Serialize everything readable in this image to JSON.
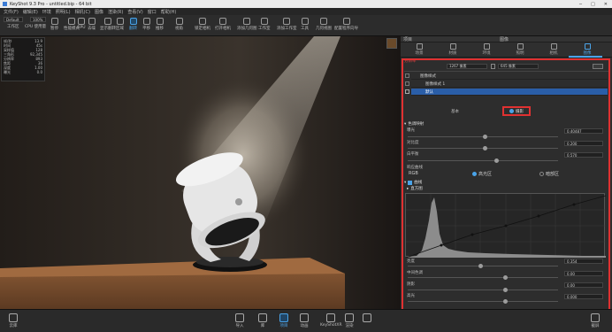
{
  "titlebar": {
    "title": "KeyShot 9.3 Pro - untitled.bip - 64 bit"
  },
  "menu": [
    "文件(F)",
    "编辑(E)",
    "环境",
    "照明(L)",
    "相机(C)",
    "图像",
    "渲染(R)",
    "查看(V)",
    "窗口",
    "帮助(H)"
  ],
  "toolbar": {
    "workspace": "Default",
    "cpu": "CPU 使用量",
    "pause": "暂停",
    "perf": "性能模式",
    "zoom": "100%",
    "items": [
      "工作区",
      "CPU 使用量",
      "暂停",
      "性能模式",
      "GPU",
      "去噪",
      "显示翻转",
      "区域",
      "翻转",
      "平移",
      "推移",
      "视角",
      "锁定相机",
      "打开相机",
      "添加几何图",
      "工作室",
      "添加工作室",
      "工具",
      "几何视图",
      "配置程序向导"
    ],
    "active": "翻转"
  },
  "hud": [
    [
      "帧/秒",
      "13.9"
    ],
    [
      "时间",
      "45s"
    ],
    [
      "采样值",
      "128"
    ],
    [
      "三角形",
      "92,345"
    ],
    [
      "分辨率",
      "893"
    ],
    [
      "焦距",
      "36"
    ],
    [
      "深度",
      "1.00"
    ],
    [
      "曝光",
      "0.0"
    ]
  ],
  "panel": {
    "header_left": "项目",
    "header_title": "图像",
    "tabs": [
      "场景",
      "材质",
      "环境",
      "照明",
      "相机",
      "图像"
    ],
    "active_tab": "图像",
    "section_label": "分辨率",
    "res_w": "1267 像素",
    "res_h": "645 像素",
    "list": [
      "图像样式",
      "图像样式 1",
      "默认"
    ],
    "subtabs": {
      "basic": "基本",
      "image": "摄影"
    },
    "group1": "色调映射",
    "group2": "曲线",
    "histogram_label": "直方图",
    "rows": [
      {
        "label": "曝光",
        "value": "0.40487"
      },
      {
        "label": "对比度",
        "value": "0.200"
      },
      {
        "label": "白平衡",
        "value": "0.570"
      }
    ],
    "channel_label": "响应曲线",
    "channels": [
      "RGB",
      "高光区",
      "暗部区"
    ],
    "bottom_rows": [
      {
        "label": "亮度",
        "value": "0.354"
      },
      {
        "label": "中间色调",
        "value": "0.00"
      },
      {
        "label": "阴影",
        "value": "0.00"
      },
      {
        "label": "高光",
        "value": "0.000"
      }
    ]
  },
  "bottombar": {
    "items": [
      "导入",
      "库",
      "项目",
      "动画",
      "KeyShotXR",
      "渲染"
    ],
    "left": "云库",
    "right": "截屏",
    "active": "项目"
  },
  "colors": {
    "accent": "#4aa3e8",
    "highlight": "#e03131"
  }
}
